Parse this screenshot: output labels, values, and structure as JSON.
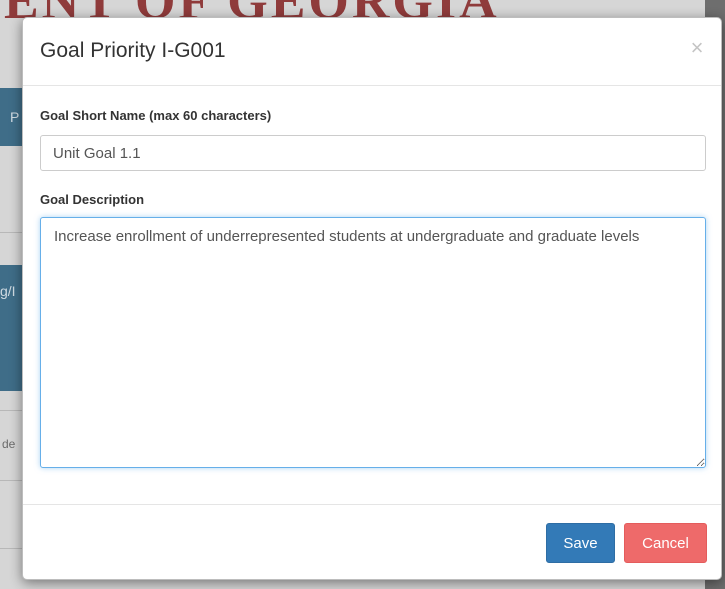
{
  "background": {
    "heading": "ENT OF GEORGIA",
    "tab_top_text": "P",
    "tab_mid_text": "g/I",
    "small_text": "de"
  },
  "modal": {
    "title": "Goal Priority I-G001",
    "close_symbol": "×",
    "short_name": {
      "label": "Goal Short Name (max 60 characters)",
      "value": "Unit Goal 1.1"
    },
    "description": {
      "label": "Goal Description",
      "value": "Increase enrollment of underrepresented students at undergraduate and graduate levels"
    },
    "buttons": {
      "save": "Save",
      "cancel": "Cancel"
    }
  },
  "colors": {
    "save_button": "#337ab7",
    "cancel_button": "#ee6a6a",
    "focus_border": "#66afe9",
    "background_heading": "#8f3b3b",
    "background_tab": "#3f6d88"
  }
}
